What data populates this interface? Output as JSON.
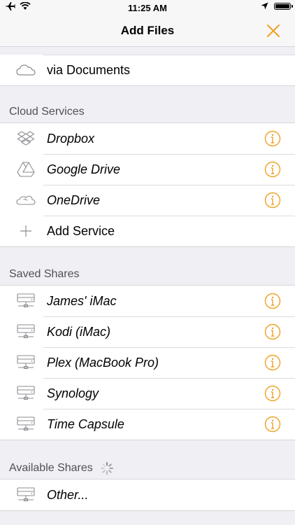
{
  "status": {
    "time": "11:25 AM"
  },
  "nav": {
    "title": "Add Files"
  },
  "top_items": [
    {
      "label": "via Documents"
    }
  ],
  "sections": {
    "cloud": {
      "title": "Cloud Services",
      "items": [
        {
          "label": "Dropbox",
          "icon": "dropbox-icon"
        },
        {
          "label": "Google Drive",
          "icon": "google-drive-icon"
        },
        {
          "label": "OneDrive",
          "icon": "onedrive-icon"
        },
        {
          "label": "Add Service",
          "icon": "plus-icon"
        }
      ]
    },
    "saved": {
      "title": "Saved Shares",
      "items": [
        {
          "label": "James' iMac"
        },
        {
          "label": "Kodi (iMac)"
        },
        {
          "label": "Plex (MacBook Pro)"
        },
        {
          "label": "Synology"
        },
        {
          "label": "Time Capsule"
        }
      ]
    },
    "available": {
      "title": "Available Shares",
      "items": [
        {
          "label": "Other..."
        }
      ]
    }
  },
  "colors": {
    "accent": "#f0a020",
    "icon_gray": "#8e8e93"
  }
}
